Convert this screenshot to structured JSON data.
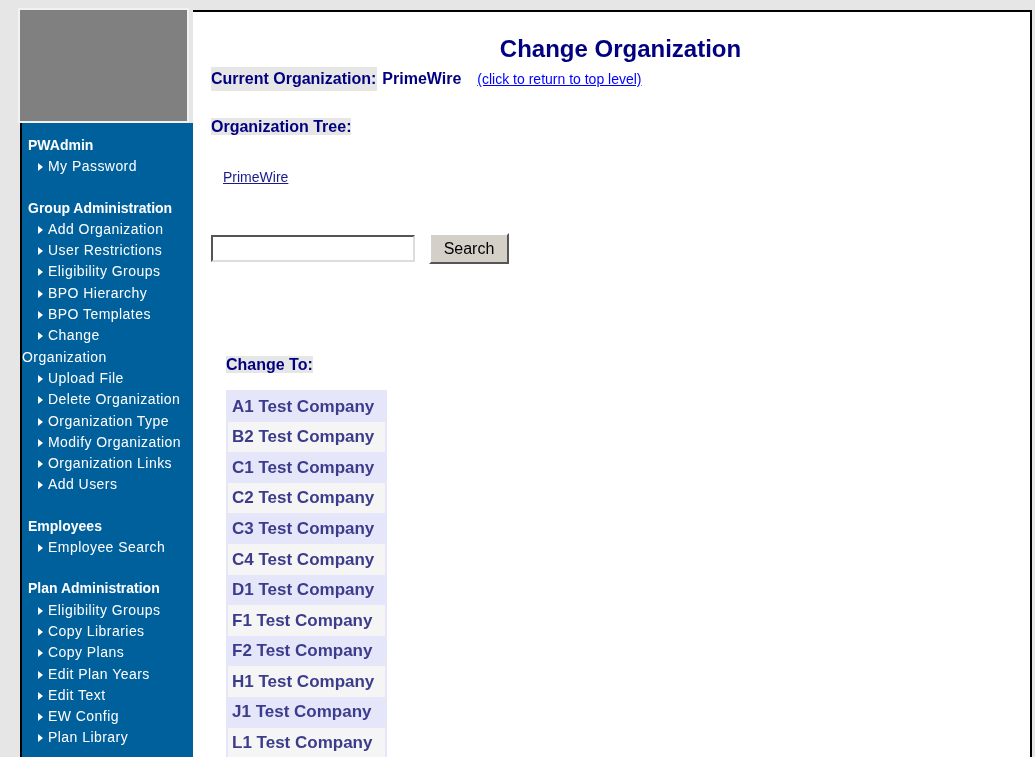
{
  "sidebar": {
    "sections": [
      {
        "heading": "PWAdmin",
        "items": [
          "My Password"
        ]
      },
      {
        "heading": "Group Administration",
        "items": [
          "Add Organization",
          "User Restrictions",
          "Eligibility Groups",
          "BPO Hierarchy",
          "BPO Templates",
          "Change Organization",
          "Upload File",
          "Delete Organization",
          "Organization Type",
          "Modify Organization",
          "Organization Links",
          "Add Users"
        ]
      },
      {
        "heading": "Employees",
        "items": [
          "Employee Search"
        ]
      },
      {
        "heading": "Plan Administration",
        "items": [
          "Eligibility Groups",
          "Copy Libraries",
          "Copy Plans",
          "Edit Plan Years",
          "Edit Text",
          "EW Config",
          "Plan Library"
        ]
      }
    ]
  },
  "page": {
    "title": "Change Organization",
    "current_label": "Current Organization:",
    "current_value": "PrimeWire",
    "return_link": "(click to return to top level)",
    "tree_label": "Organization Tree:",
    "tree": [
      {
        "label": "PrimeWire"
      }
    ],
    "search_button": "Search",
    "change_to_label": "Change To:",
    "companies": [
      "A1 Test Company",
      "B2 Test Company",
      "C1 Test Company",
      "C2 Test Company",
      "C3 Test Company",
      "C4 Test Company",
      "D1 Test Company",
      "F1 Test Company",
      "F2 Test Company",
      "H1 Test Company",
      "J1 Test Company",
      "L1 Test Company"
    ]
  }
}
